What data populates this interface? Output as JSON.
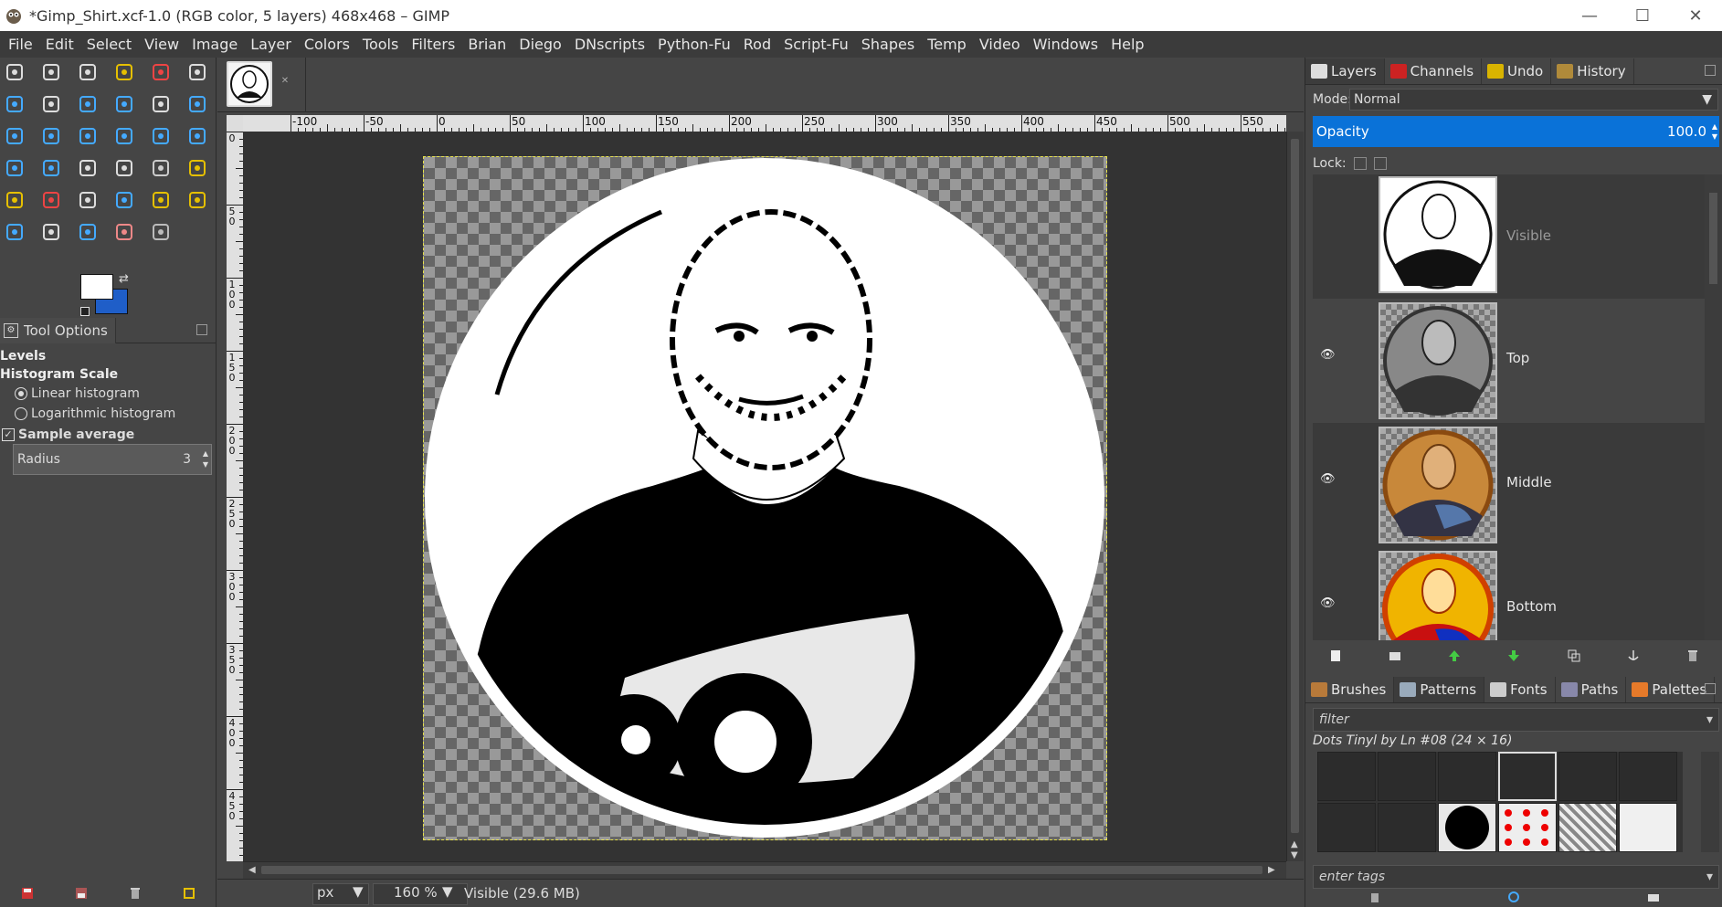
{
  "window": {
    "title": "*Gimp_Shirt.xcf-1.0 (RGB color, 5 layers) 468x468 – GIMP",
    "minimize": "—",
    "maximize": "☐",
    "close": "✕"
  },
  "menubar": {
    "items": [
      "File",
      "Edit",
      "Select",
      "View",
      "Image",
      "Layer",
      "Colors",
      "Tools",
      "Filters",
      "Brian",
      "Diego",
      "DNscripts",
      "Python-Fu",
      "Rod",
      "Script-Fu",
      "Shapes",
      "Temp",
      "Video",
      "Windows",
      "Help"
    ]
  },
  "toolbox": {
    "fg_color": "#ffffff",
    "bg_color": "#1f5ec8",
    "tools": [
      "rect-select",
      "ellipse-select",
      "free-select",
      "fuzzy-select",
      "select-by-color",
      "scissors",
      "foreground-select",
      "paths",
      "color-picker",
      "zoom",
      "measure",
      "move",
      "align",
      "crop",
      "rotate",
      "scale",
      "shear",
      "perspective",
      "unified-transform",
      "handle-transform",
      "text",
      "bucket-fill",
      "blend",
      "pencil",
      "paintbrush",
      "eraser",
      "airbrush",
      "ink",
      "mypaint",
      "clone",
      "heal",
      "perspective-clone",
      "blur",
      "smudge",
      "dodge-burn"
    ]
  },
  "tool_options": {
    "tab_label": "Tool Options",
    "tool_name": "Levels",
    "histogram_scale_label": "Histogram Scale",
    "linear_label": "Linear histogram",
    "log_label": "Logarithmic histogram",
    "sample_average_label": "Sample average",
    "radius_label": "Radius",
    "radius_value": "3"
  },
  "canvas": {
    "hruler_labels": [
      "-100",
      "-50",
      "0",
      "50",
      "100",
      "150",
      "200",
      "250",
      "300",
      "350",
      "400",
      "450",
      "500",
      "550"
    ],
    "vruler_labels": [
      "0",
      "50",
      "100",
      "150",
      "200",
      "250",
      "300",
      "350",
      "400",
      "450"
    ]
  },
  "statusbar": {
    "unit": "px",
    "zoom": "160 %",
    "message": "Visible (29.6 MB)"
  },
  "layers_panel": {
    "tabs": [
      "Layers",
      "Channels",
      "Undo",
      "History"
    ],
    "mode_label": "Mode:",
    "mode_value": "Normal",
    "opacity_label": "Opacity",
    "opacity_value": "100.0",
    "lock_label": "Lock:",
    "layers": [
      {
        "name": "Visible",
        "visible": false
      },
      {
        "name": "Top",
        "visible": true
      },
      {
        "name": "Middle",
        "visible": true
      },
      {
        "name": "Bottom",
        "visible": true
      }
    ]
  },
  "patterns_panel": {
    "tabs": [
      "Brushes",
      "Patterns",
      "Fonts",
      "Paths",
      "Palettes"
    ],
    "filter_placeholder": "filter",
    "selected_pattern": "Dots Tinyl by Ln #08 (24 × 16)",
    "tags_placeholder": "enter tags"
  }
}
